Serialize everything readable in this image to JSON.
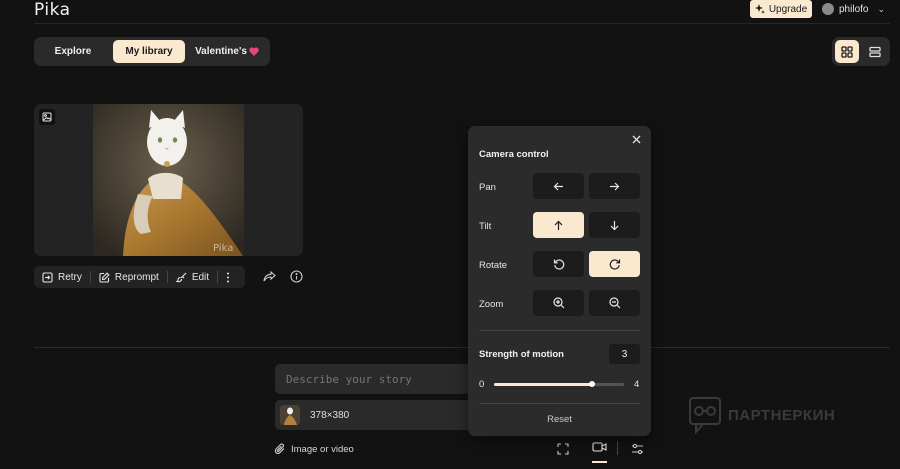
{
  "header": {
    "logo": "Pika",
    "upgrade_label": "Upgrade",
    "username": "philofo"
  },
  "tabs": [
    {
      "label": "Explore",
      "active": false
    },
    {
      "label": "My library",
      "active": true
    },
    {
      "label": "Valentine's",
      "active": false
    }
  ],
  "view_toggle": {
    "grid_active": true
  },
  "card": {
    "watermark": "Pika",
    "actions": {
      "retry": "Retry",
      "reprompt": "Reprompt",
      "edit": "Edit"
    }
  },
  "prompt": {
    "placeholder": "Describe your story",
    "image_size": "378×380",
    "attach_label": "Image or video"
  },
  "camera_panel": {
    "title": "Camera control",
    "rows": {
      "pan": "Pan",
      "tilt": "Tilt",
      "rotate": "Rotate",
      "zoom": "Zoom"
    },
    "strength_label": "Strength of motion",
    "strength_value": "3",
    "slider_min": "0",
    "slider_max": "4",
    "slider_fraction": 0.75,
    "reset_label": "Reset"
  },
  "watermark_text": "ПАРТНЕРКИН",
  "colors": {
    "accent": "#fbe9cf",
    "background": "#121212",
    "surface": "#2a2a2a",
    "heart": "#e8457a"
  }
}
